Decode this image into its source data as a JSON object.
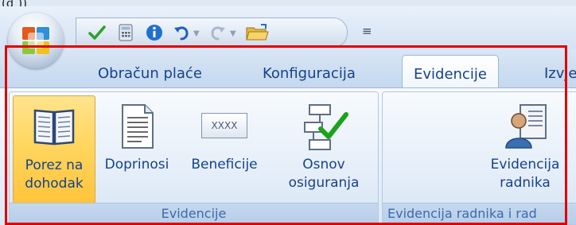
{
  "crop_text": "(d ))",
  "tabs": [
    {
      "label": "Obračun plaće"
    },
    {
      "label": "Konfiguracija"
    },
    {
      "label": "Evidencije"
    },
    {
      "label": "Izvje"
    }
  ],
  "qat": {
    "more_glyph": "≡"
  },
  "groups": [
    {
      "label": "Evidencije",
      "buttons": [
        {
          "label": "Porez na\ndohodak"
        },
        {
          "label": "Doprinosi"
        },
        {
          "label": "Beneficije"
        },
        {
          "label": "Osnov\nosiguranja"
        }
      ],
      "xxxx_text": "XXXX"
    },
    {
      "label": "Evidencija radnika i rad",
      "buttons": [
        {
          "label": "Evidencija\nradnika"
        }
      ]
    }
  ],
  "colors": {
    "highlight": "#ffd660",
    "annotation": "#e00000",
    "tab_text": "#15428b"
  },
  "icons": [
    "office-logo-icon",
    "checkmark-icon",
    "calculator-icon",
    "info-icon",
    "undo-icon",
    "redo-icon",
    "open-folder-icon",
    "book-icon",
    "document-icon",
    "xxxx-icon",
    "flowchart-check-icon",
    "employee-record-icon"
  ]
}
